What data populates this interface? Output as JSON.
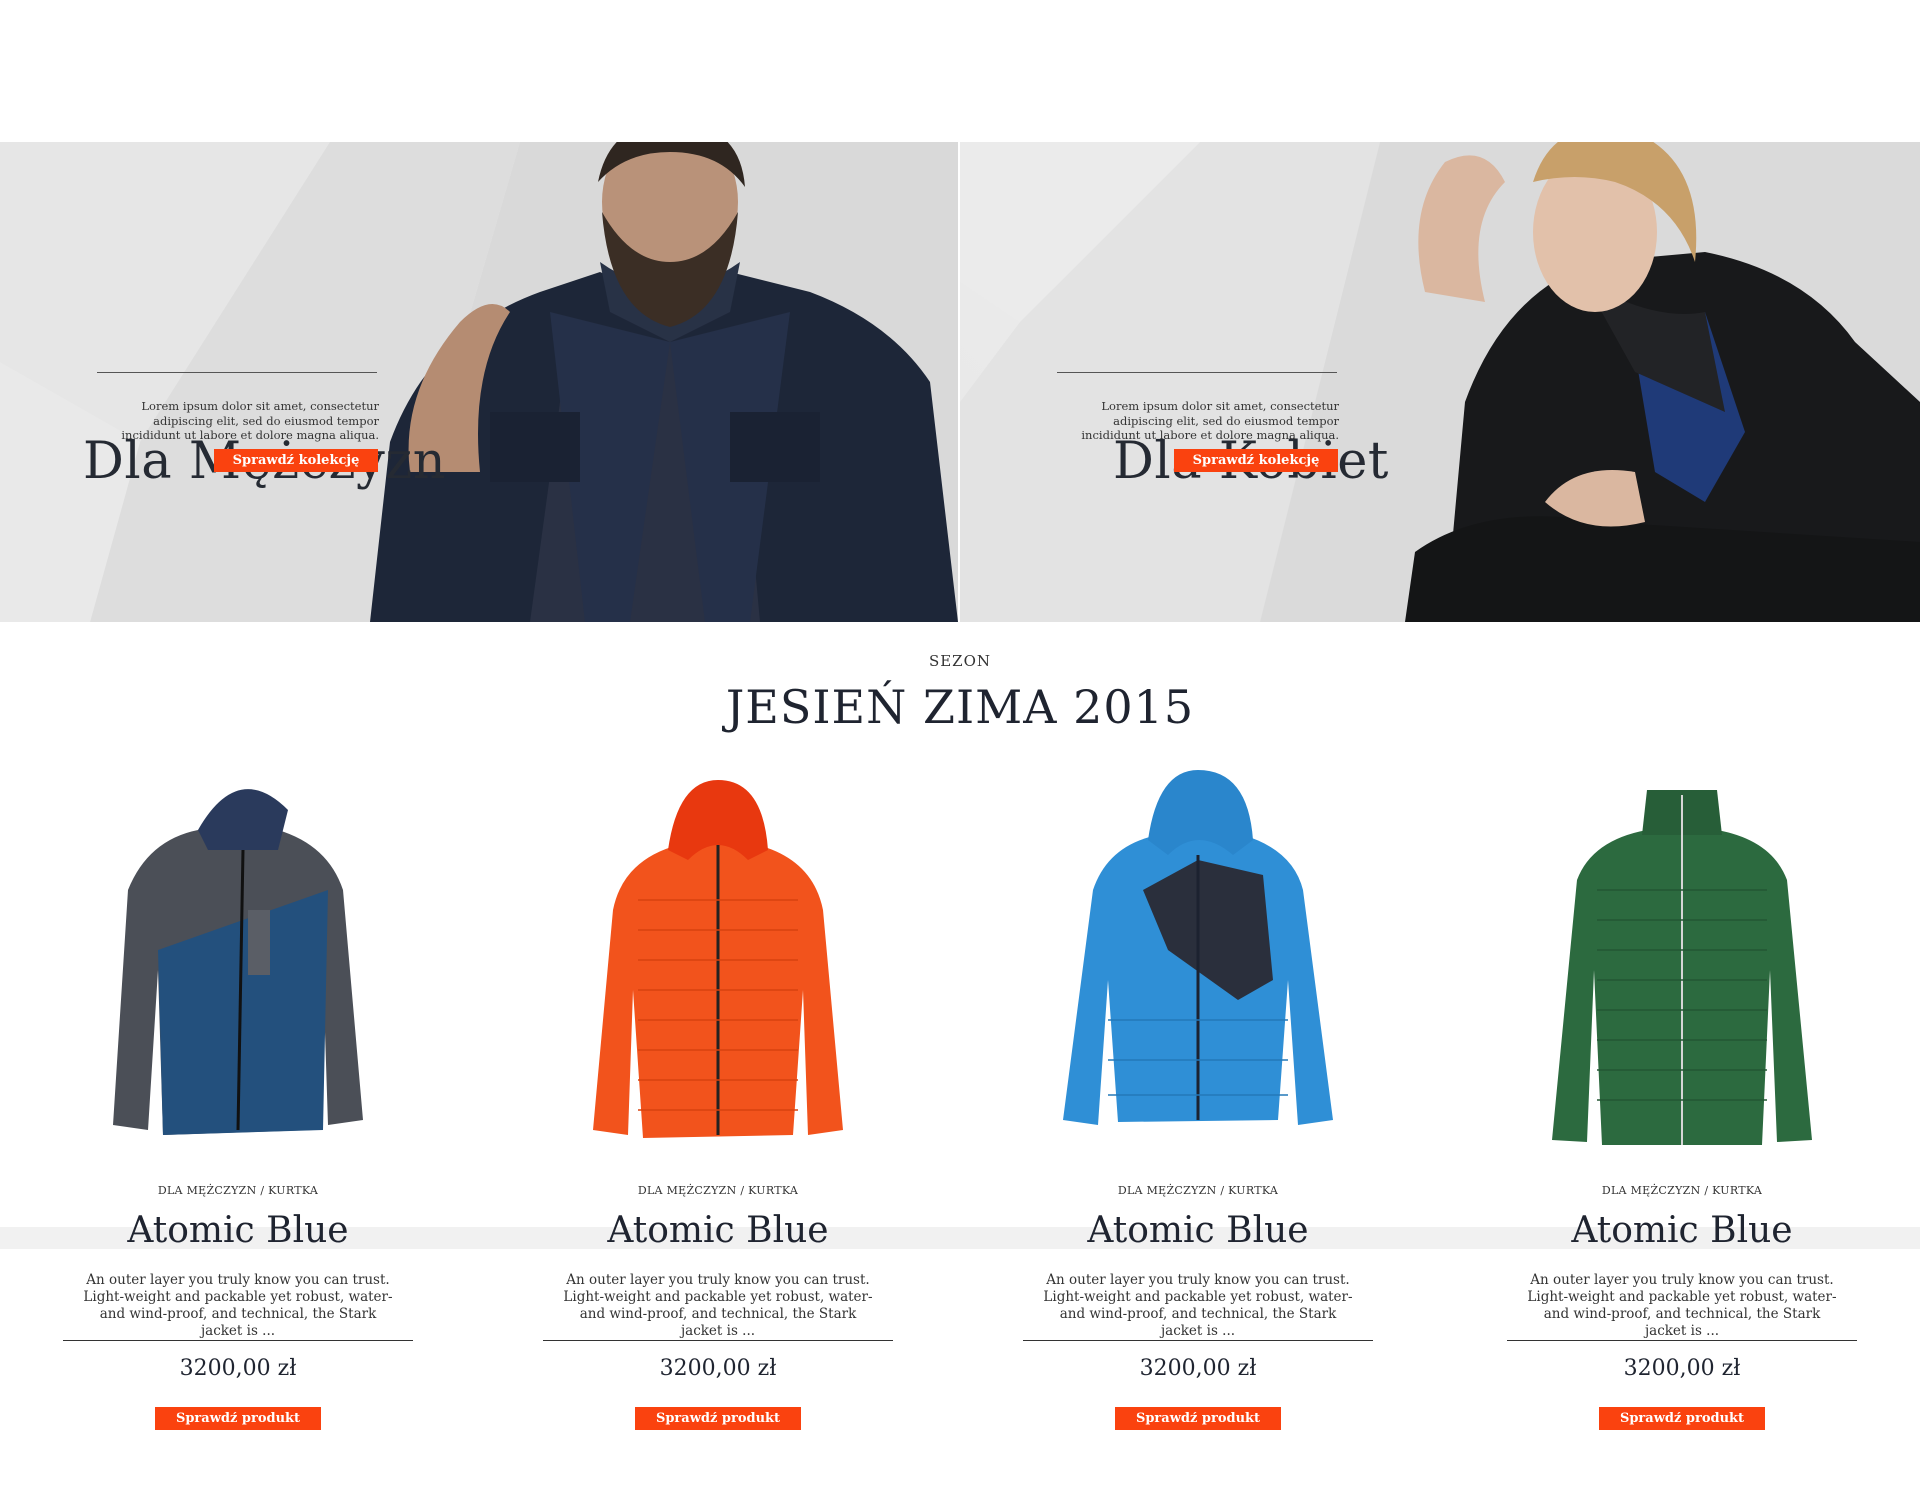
{
  "colors": {
    "accent": "#fa420f",
    "text": "#1f2430"
  },
  "heroes": [
    {
      "title": "Dla Mężczyzn",
      "text": "Lorem ipsum dolor sit amet, consectetur adipiscing elit, sed do eiusmod tempor incididunt ut labore et dolore magna aliqua.",
      "button": "Sprawdź kolekcję"
    },
    {
      "title": "Dla Kobiet",
      "text": "Lorem ipsum dolor sit amet, consectetur adipiscing elit, sed do eiusmod tempor incididunt ut labore et dolore magna aliqua.",
      "button": "Sprawdź kolekcję"
    }
  ],
  "season": {
    "label": "SEZON",
    "title": "JESIEŃ ZIMA 2015"
  },
  "products": [
    {
      "category": "DLA MĘŻCZYZN / KURTKA",
      "name": "Atomic Blue",
      "description": "An outer layer you truly know you can trust. Light-weight and packable yet robust, water- and wind-proof, and technical, the Stark jacket is ...",
      "price": "3200,00 zł",
      "button": "Sprawdź produkt",
      "image": "jacket-blue-grey"
    },
    {
      "category": "DLA MĘŻCZYZN / KURTKA",
      "name": "Atomic Blue",
      "description": "An outer layer you truly know you can trust. Light-weight and packable yet robust, water- and wind-proof, and technical, the Stark jacket is ...",
      "price": "3200,00 zł",
      "button": "Sprawdź produkt",
      "image": "jacket-orange-down"
    },
    {
      "category": "DLA MĘŻCZYZN / KURTKA",
      "name": "Atomic Blue",
      "description": "An outer layer you truly know you can trust. Light-weight and packable yet robust, water- and wind-proof, and technical, the Stark jacket is ...",
      "price": "3200,00 zł",
      "button": "Sprawdź produkt",
      "image": "jacket-light-blue-down"
    },
    {
      "category": "DLA MĘŻCZYZN / KURTKA",
      "name": "Atomic Blue",
      "description": "An outer layer you truly know you can trust. Light-weight and packable yet robust, water- and wind-proof, and technical, the Stark jacket is ...",
      "price": "3200,00 zł",
      "button": "Sprawdź produkt",
      "image": "jacket-green-down"
    }
  ]
}
